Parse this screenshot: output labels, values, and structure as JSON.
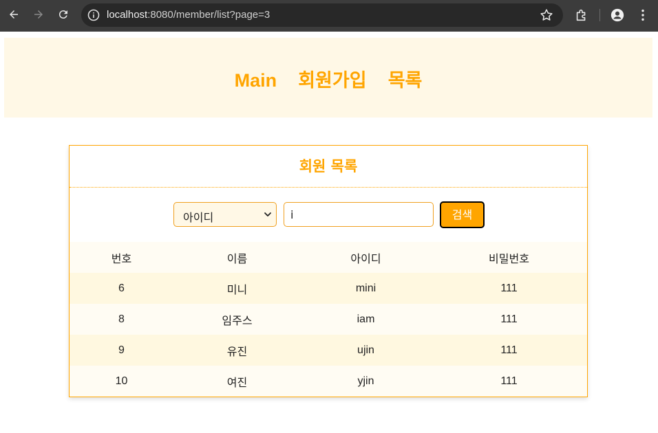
{
  "browser": {
    "url_host": "localhost",
    "url_rest": ":8080/member/list?page=3",
    "back_icon": "arrow-left-icon",
    "forward_icon": "arrow-right-icon",
    "reload_icon": "reload-icon"
  },
  "header": {
    "nav": [
      "Main",
      "회원가입",
      "목록"
    ]
  },
  "card": {
    "title": "회원 목록"
  },
  "search": {
    "select_value": "아이디",
    "input_value": "i",
    "button_label": "검색"
  },
  "table": {
    "headers": [
      "번호",
      "이름",
      "아이디",
      "비밀번호"
    ],
    "rows": [
      [
        "6",
        "미니",
        "mini",
        "111"
      ],
      [
        "8",
        "임주스",
        "iam",
        "111"
      ],
      [
        "9",
        "유진",
        "ujin",
        "111"
      ],
      [
        "10",
        "여진",
        "yjin",
        "111"
      ]
    ]
  },
  "colors": {
    "accent": "#ffa500",
    "header_bg": "#fff8e6",
    "chrome_bg": "#3c3c3c"
  }
}
